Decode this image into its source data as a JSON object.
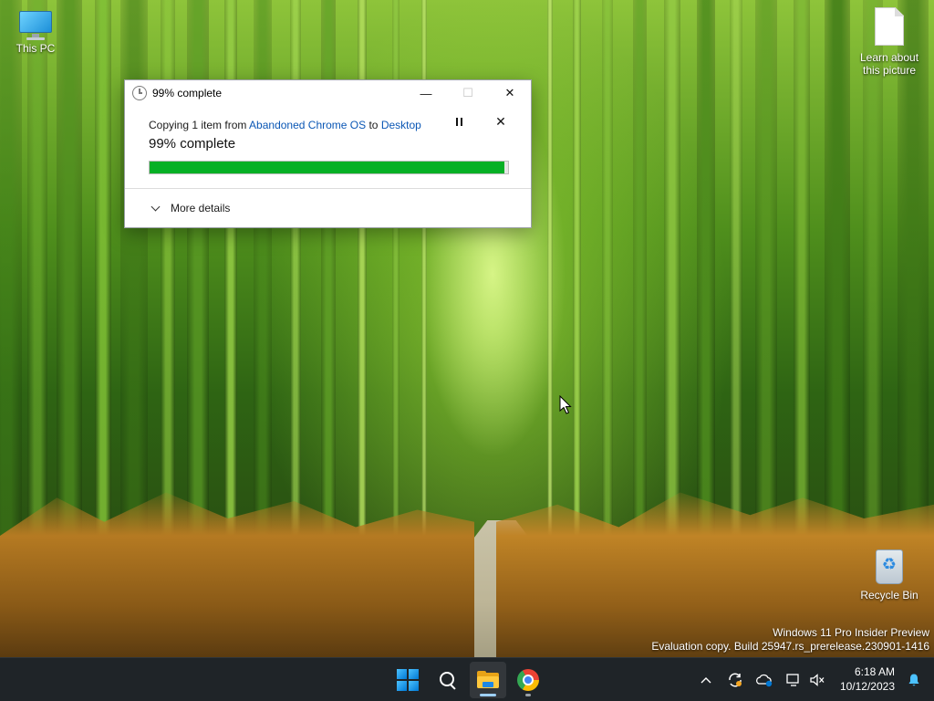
{
  "desktop": {
    "icons": [
      {
        "label": "This PC",
        "icon": "this-pc-icon"
      },
      {
        "label": "Learn about this picture",
        "icon": "document-icon"
      },
      {
        "label": "Recycle Bin",
        "icon": "recycle-bin-icon"
      }
    ],
    "watermark": {
      "line1": "Windows 11 Pro Insider Preview",
      "line2": "Evaluation copy. Build 25947.rs_prerelease.230901-1416"
    }
  },
  "dialog": {
    "title": "99% complete",
    "copy_prefix": "Copying 1 item from ",
    "source": "Abandoned Chrome OS",
    "copy_mid": " to ",
    "destination": "Desktop",
    "percent_text": "99% complete",
    "progress_value": 0.99,
    "more_details": "More details",
    "buttons": {
      "minimize": "—",
      "maximize": "☐",
      "close": "✕",
      "cancel": "✕"
    },
    "colors": {
      "progress": "#06b025",
      "link": "#0b57b5"
    }
  },
  "taskbar": {
    "apps": [
      {
        "name": "Start",
        "icon": "windows-start-icon"
      },
      {
        "name": "Search",
        "icon": "search-icon"
      },
      {
        "name": "File Explorer",
        "icon": "file-explorer-icon",
        "active": true
      },
      {
        "name": "Google Chrome",
        "icon": "chrome-icon",
        "running": true
      }
    ],
    "tray": {
      "icons": [
        "chevron-up-icon",
        "sync-icon",
        "onedrive-icon",
        "network-icon",
        "volume-muted-icon"
      ],
      "show_hidden": "︿"
    },
    "clock": {
      "time": "6:18 AM",
      "date": "10/12/2023"
    }
  }
}
